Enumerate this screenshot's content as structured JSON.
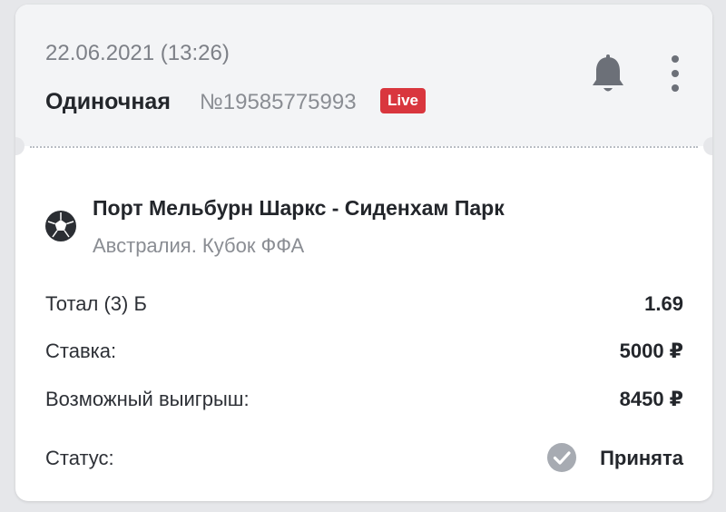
{
  "bet": {
    "datetime": "22.06.2021 (13:26)",
    "type": "Одиночная",
    "number": "№19585775993",
    "live_badge": "Live"
  },
  "event": {
    "title": "Порт Мельбурн Шаркс - Сиденхам Парк",
    "league": "Австралия. Кубок ФФА",
    "icon": "soccer-ball-icon"
  },
  "details": {
    "market_label": "Тотал (3) Б",
    "market_odds": "1.69",
    "stake_label": "Ставка:",
    "stake_value": "5000 ₽",
    "payout_label": "Возможный выигрыш:",
    "payout_value": "8450 ₽",
    "status_label": "Статус:",
    "status_value": "Принята",
    "status_icon": "check-circle-icon"
  },
  "icons": {
    "notification": "bell-icon",
    "menu": "more-vertical-icon"
  },
  "colors": {
    "live_badge": "#d9363e",
    "header_bg": "#f3f4f6",
    "status_icon": "#a7abb2"
  }
}
